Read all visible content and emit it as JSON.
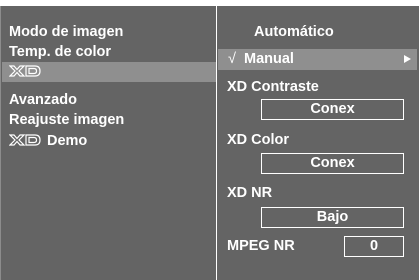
{
  "left_menu": {
    "items": [
      {
        "label": "Modo de imagen"
      },
      {
        "label": "Temp. de color"
      },
      {
        "label": "",
        "icon": "xd-logo-icon",
        "selected": true
      },
      {
        "label": "Avanzado"
      },
      {
        "label": "Reajuste imagen"
      },
      {
        "label": "Demo",
        "icon": "xd-logo-icon"
      }
    ]
  },
  "right_menu": {
    "automatic_label": "Automático",
    "manual": {
      "check_mark": "√",
      "label": "Manual",
      "arrow_icon": "triangle-right-icon"
    },
    "xd_contrast": {
      "label": "XD Contraste",
      "value": "Conex"
    },
    "xd_color": {
      "label": "XD Color",
      "value": "Conex"
    },
    "xd_nr": {
      "label": "XD NR",
      "value": "Bajo"
    },
    "mpeg_nr": {
      "label": "MPEG NR",
      "value": "0"
    }
  },
  "colors": {
    "panel_background": "#646464",
    "selected_background": "#8f8f8f",
    "text": "#ffffff",
    "outer_background": "#ffffff"
  }
}
